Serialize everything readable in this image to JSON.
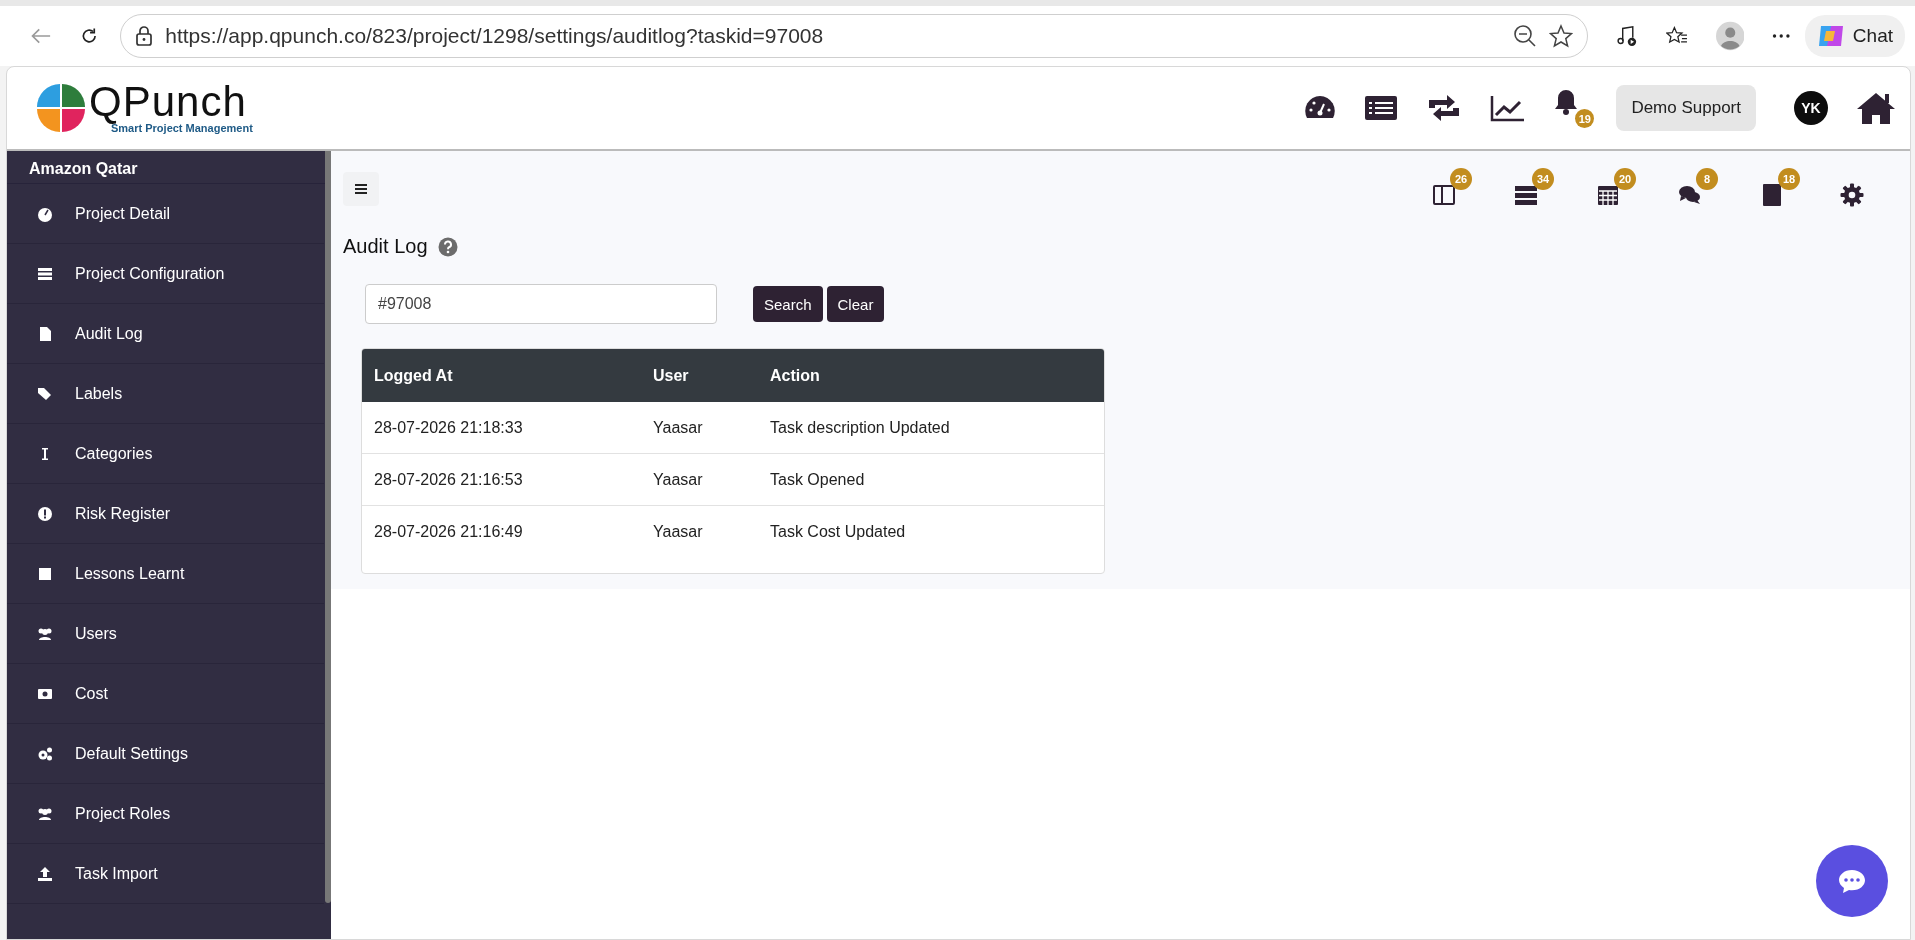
{
  "browser": {
    "url": "https://app.qpunch.co/823/project/1298/settings/auditlog?taskid=97008",
    "chat_label": "Chat"
  },
  "header": {
    "logo_title": "QPunch",
    "logo_tagline": "Smart Project Management",
    "notification_count": "19",
    "user_button": "Demo Support",
    "avatar_initials": "YK"
  },
  "sidebar": {
    "project": "Amazon Qatar",
    "items": [
      {
        "label": "Project Detail"
      },
      {
        "label": "Project Configuration"
      },
      {
        "label": "Audit Log"
      },
      {
        "label": "Labels"
      },
      {
        "label": "Categories"
      },
      {
        "label": "Risk Register"
      },
      {
        "label": "Lessons Learnt"
      },
      {
        "label": "Users"
      },
      {
        "label": "Cost"
      },
      {
        "label": "Default Settings"
      },
      {
        "label": "Project Roles"
      },
      {
        "label": "Task Import"
      }
    ]
  },
  "toolbar": {
    "badges": [
      "26",
      "34",
      "20",
      "8",
      "18"
    ]
  },
  "page": {
    "title": "Audit Log",
    "search": {
      "value": "#97008"
    },
    "buttons": [
      "Search",
      "Clear"
    ]
  },
  "table": {
    "columns": [
      "Logged At",
      "User",
      "Action"
    ],
    "rows": [
      [
        "28-07-2026 21:18:33",
        "Yaasar",
        "Task description Updated"
      ],
      [
        "28-07-2026 21:16:53",
        "Yaasar",
        "Task Opened"
      ],
      [
        "28-07-2026 21:16:49",
        "Yaasar",
        "Task Cost Updated"
      ]
    ]
  }
}
